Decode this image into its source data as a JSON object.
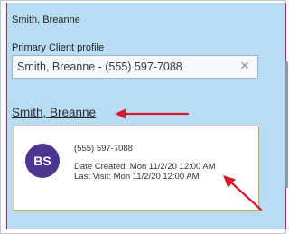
{
  "header": {
    "client_name": "Smith, Breanne"
  },
  "primary_profile": {
    "label": "Primary Client profile",
    "value": "Smith, Breanne - (555) 597-7088",
    "clear_icon": "×"
  },
  "client_link": "Smith, Breanne",
  "card": {
    "initials": "BS",
    "avatar_color": "#4e3590",
    "phone": "(555) 597-7088",
    "date_created": "Date Created:   Mon 11/2/20 12:00 AM",
    "last_visit": "Last Visit:   Mon 11/2/20 12:00 AM"
  },
  "colors": {
    "panel_background": "#b9dcf5",
    "annotation_arrow": "#d8182f",
    "card_border": "#c9a845"
  }
}
